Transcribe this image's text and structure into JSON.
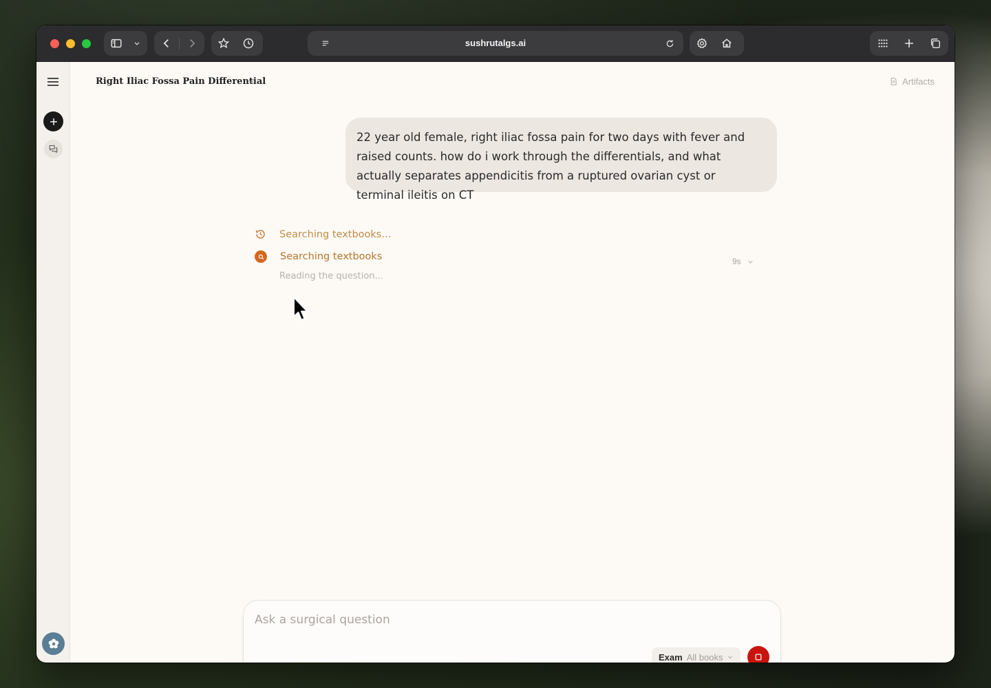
{
  "browser": {
    "url": "sushrutalgs.ai"
  },
  "header": {
    "conversation_title": "Right Iliac Fossa Pain Differential",
    "artifacts_label": "Artifacts"
  },
  "message": {
    "user_text": "22 year old female, right iliac fossa pain for two days with fever and raised counts. how do i work through the differentials, and what actually separates appendicitis from a ruptured ovarian cyst or terminal ileitis on CT"
  },
  "progress": {
    "step1_label": "Searching textbooks...",
    "elapsed": "9s",
    "step2_label": "Searching textbooks",
    "step2_detail": "Reading the question..."
  },
  "composer": {
    "placeholder": "Ask a surgical question",
    "mode": "Exam",
    "scope": "All books"
  },
  "colors": {
    "accent_orange": "#d3671e",
    "stop_red": "#c9150f"
  }
}
